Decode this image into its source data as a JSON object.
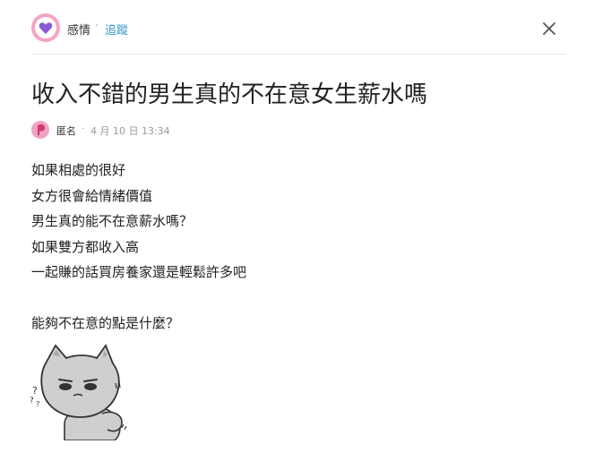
{
  "header": {
    "board_name": "感情",
    "separator": "·",
    "follow_label": "追蹤",
    "board_icon": "heart-icon",
    "close_icon": "close-icon"
  },
  "post": {
    "title": "收入不錯的男生真的不在意女生薪水嗎",
    "author": "匿名",
    "meta_separator": "·",
    "timestamp": "4 月 10 日 13:34",
    "lines": [
      "如果相處的很好",
      "女方很會給情緒價值",
      "男生真的能不在意薪水嗎？",
      "如果雙方都收入高",
      "一起賺的話買房養家還是輕鬆許多吧",
      "",
      "能夠不在意的點是什麼？"
    ]
  },
  "colors": {
    "accent_link": "#3397cf",
    "board_avatar_bg": "#f6a3c4",
    "heart": "#8a5bd6",
    "divider": "#e6e6e6"
  }
}
